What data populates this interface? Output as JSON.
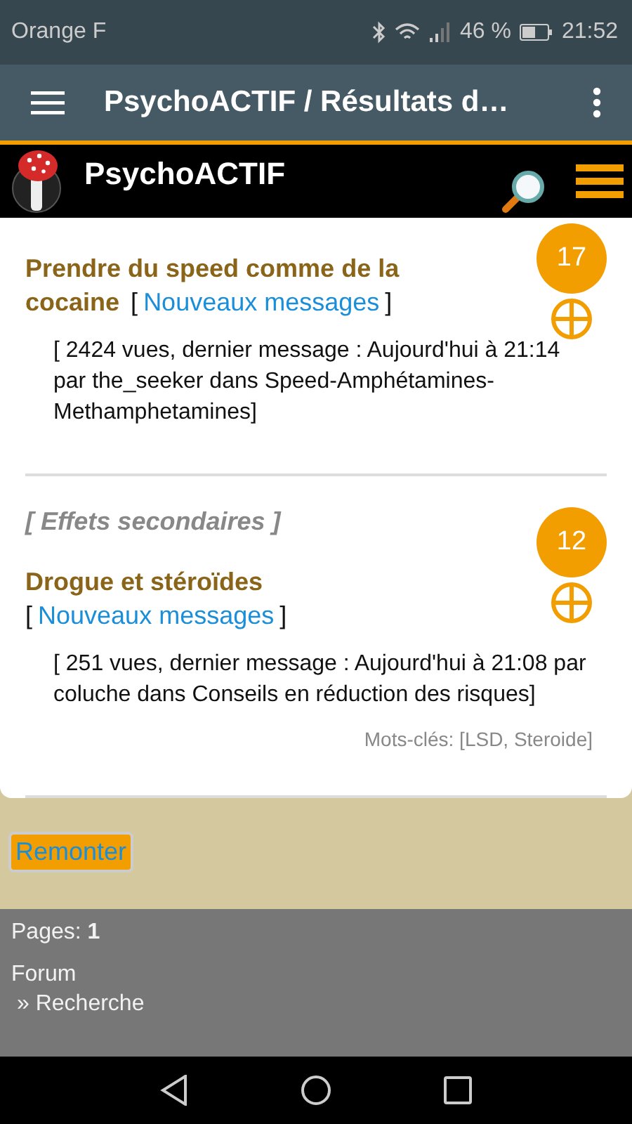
{
  "status_bar": {
    "carrier": "Orange F",
    "battery": "46 %",
    "time": "21:52"
  },
  "app_bar": {
    "title": "PsychoACTIF / Résultats d…"
  },
  "site_header": {
    "title": "PsychoACTIF"
  },
  "topics": [
    {
      "badge": "17",
      "title": "Prendre du speed comme de la cocaine",
      "link": {
        "open": "[",
        "label": "Nouveaux messages",
        "close": "]"
      },
      "meta": "[ 2424 vues, dernier message : Aujourd'hui à 21:14 par the_seeker dans Speed-Amphétamines-Methamphetamines]"
    },
    {
      "category": "[ Effets secondaires ]",
      "badge": "12",
      "title": "Drogue et stéroïdes",
      "link": {
        "open": "[",
        "label": "Nouveaux messages",
        "close": "]"
      },
      "meta": "[ 251 vues, dernier message : Aujourd'hui à 21:08 par coluche dans Conseils en réduction des risques]",
      "keywords": "Mots-clés: [LSD, Steroide]"
    }
  ],
  "top_button": "Remonter",
  "footer": {
    "pages": "Pages: **1**",
    "breadcrumb": [
      "Forum",
      "» Recherche"
    ]
  }
}
